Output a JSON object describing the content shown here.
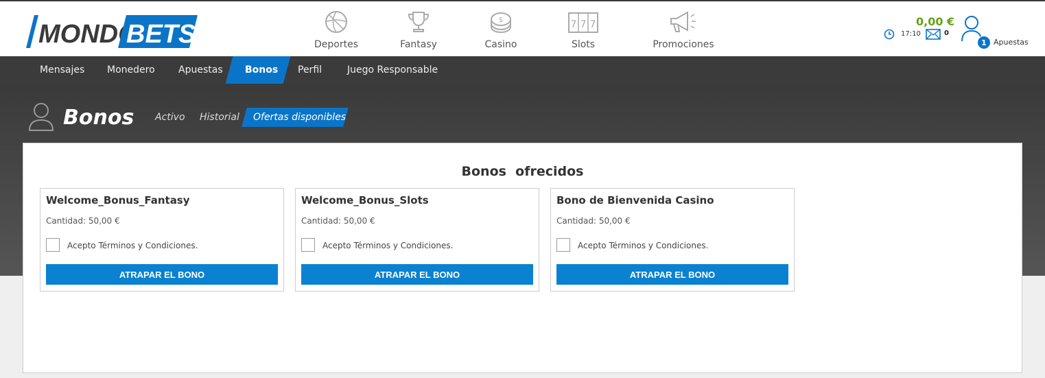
{
  "brand": {
    "part1": "MONDO",
    "part2": "BETS",
    "color_dark": "#3a3a3a",
    "color_blue": "#0a75c8"
  },
  "main_nav": [
    {
      "label": "Deportes",
      "icon": "soccer-ball-icon"
    },
    {
      "label": "Fantasy",
      "icon": "trophy-icon"
    },
    {
      "label": "Casino",
      "icon": "chips-icon"
    },
    {
      "label": "Slots",
      "icon": "slot-machine-icon"
    },
    {
      "label": "Promociones",
      "icon": "megaphone-icon"
    }
  ],
  "account": {
    "balance": "0,00 €",
    "time": "17:10",
    "messages": "0",
    "bets_count": "1",
    "bets_label": "Apuestas",
    "balance_color": "#66a313"
  },
  "sub_nav": [
    {
      "label": "Mensajes"
    },
    {
      "label": "Monedero"
    },
    {
      "label": "Apuestas"
    },
    {
      "label": "Bonos",
      "active": true
    },
    {
      "label": "Perfil"
    },
    {
      "label": "Juego Responsable"
    }
  ],
  "page": {
    "title": "Bonos",
    "tabs": [
      {
        "label": "Activo"
      },
      {
        "label": "Historial"
      },
      {
        "label": "Ofertas disponibles",
        "active": true
      }
    ]
  },
  "offers": {
    "section_title": "Bonos  ofrecidos",
    "cards": [
      {
        "title": "Welcome_Bonus_Fantasy",
        "amount": "Cantidad: 50,00 €",
        "terms": "Acepto Términos y Condiciones.",
        "button": "ATRAPAR EL BONO"
      },
      {
        "title": "Welcome_Bonus_Slots",
        "amount": "Cantidad: 50,00 €",
        "terms": "Acepto Términos y Condiciones.",
        "button": "ATRAPAR EL BONO"
      },
      {
        "title": "Bono de Bienvenida Casino",
        "amount": "Cantidad: 50,00 €",
        "terms": "Acepto Términos y Condiciones.",
        "button": "ATRAPAR EL BONO"
      }
    ]
  }
}
